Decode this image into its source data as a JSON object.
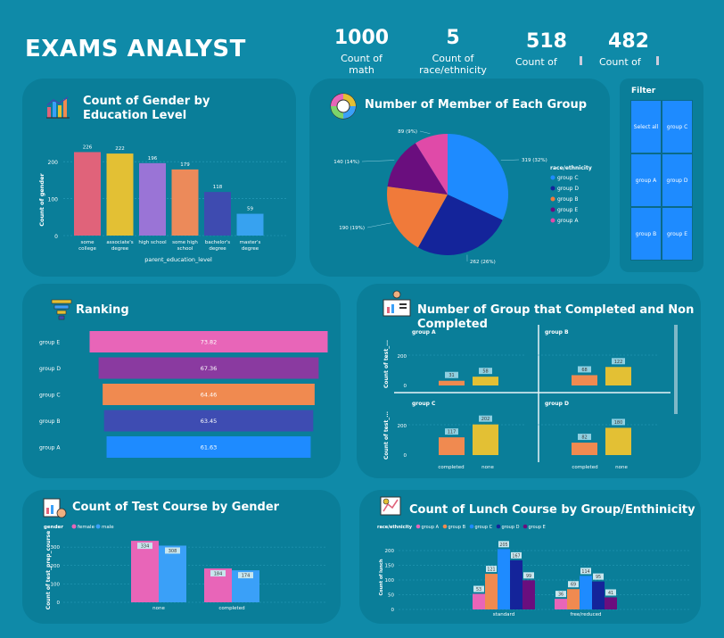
{
  "title": "EXAMS ANALYST",
  "kpis": [
    {
      "value": "1000",
      "label": "Count of math"
    },
    {
      "value": "5",
      "label": "Count of race/ethnicity"
    },
    {
      "value": "518",
      "label": "Count of"
    },
    {
      "value": "482",
      "label": "Count of"
    }
  ],
  "gender_edu": {
    "title": "Count of Gender by Education Level",
    "ylabel": "Count of gender",
    "xlabel": "parent_education_level",
    "categories": [
      "some college",
      "associate's degree",
      "high school",
      "some high school",
      "bachelor's degree",
      "master's degree"
    ],
    "values": [
      226,
      222,
      196,
      179,
      118,
      59
    ],
    "colors": [
      "#e0637a",
      "#e3c034",
      "#9a74d6",
      "#ec8a5a",
      "#3e4bb0",
      "#37a2f0"
    ],
    "yticks": [
      "0",
      "100",
      "200"
    ]
  },
  "groups": {
    "title": "Number of Member of Each Group",
    "legend_title": "race/ethnicity",
    "slices": [
      {
        "name": "group C",
        "value": 319,
        "label": "319 (32%)",
        "color": "#1e8bff"
      },
      {
        "name": "group D",
        "value": 262,
        "label": "262 (26%)",
        "color": "#14249a"
      },
      {
        "name": "group B",
        "value": 190,
        "label": "190 (19%)",
        "color": "#f07a3a"
      },
      {
        "name": "group E",
        "value": 140,
        "label": "140 (14%)",
        "color": "#6a0e7e"
      },
      {
        "name": "group A",
        "value": 89,
        "label": "89 (9%)",
        "color": "#e04aa8"
      }
    ]
  },
  "filter": {
    "title": "Filter",
    "buttons": [
      "Select all",
      "group C",
      "group A",
      "group D",
      "group B",
      "group E"
    ]
  },
  "ranking": {
    "title": "Ranking",
    "items": [
      {
        "name": "group E",
        "value": "73.82",
        "color": "#e865b8"
      },
      {
        "name": "group D",
        "value": "67.36",
        "color": "#8a3aa0"
      },
      {
        "name": "group C",
        "value": "64.46",
        "color": "#f08a50"
      },
      {
        "name": "group B",
        "value": "63.45",
        "color": "#3e4cb2"
      },
      {
        "name": "group A",
        "value": "61.63",
        "color": "#1e8bff"
      }
    ]
  },
  "completed": {
    "title": "Number of Group that Completed and Non Completed",
    "ylabel": "Count of test_...",
    "categories": [
      "completed",
      "none"
    ],
    "groups": [
      {
        "name": "group A",
        "values": [
          31,
          58
        ]
      },
      {
        "name": "group B",
        "values": [
          68,
          122
        ]
      },
      {
        "name": "group C",
        "values": [
          117,
          202
        ]
      },
      {
        "name": "group D",
        "values": [
          82,
          180
        ]
      }
    ],
    "yticks": [
      "0",
      "200"
    ],
    "colors": [
      "#f08a50",
      "#e3c034"
    ]
  },
  "test_course": {
    "title": "Count of Test Course by Gender",
    "legend_title": "gender",
    "ylabel": "Count of test_prep_course",
    "categories": [
      "none",
      "completed"
    ],
    "series": [
      {
        "name": "female",
        "values": [
          334,
          184
        ],
        "color": "#e865b8"
      },
      {
        "name": "male",
        "values": [
          308,
          174
        ],
        "color": "#3aa0f8"
      }
    ],
    "yticks": [
      "0",
      "100",
      "200",
      "300"
    ]
  },
  "lunch": {
    "title": "Count of Lunch Course by Group/Enthinicity",
    "legend_title": "race/ethnicity",
    "ylabel": "Count of lunch",
    "categories": [
      "standard",
      "free/reduced"
    ],
    "series": [
      {
        "name": "group A",
        "values": [
          53,
          36
        ],
        "color": "#e865b8"
      },
      {
        "name": "group B",
        "values": [
          121,
          69
        ],
        "color": "#f08a50"
      },
      {
        "name": "group C",
        "values": [
          205,
          114
        ],
        "color": "#1e8bff"
      },
      {
        "name": "group D",
        "values": [
          167,
          95
        ],
        "color": "#14249a"
      },
      {
        "name": "group E",
        "values": [
          99,
          41
        ],
        "color": "#6a0e7e"
      }
    ],
    "yticks": [
      "0",
      "50",
      "100",
      "150",
      "200"
    ]
  }
}
